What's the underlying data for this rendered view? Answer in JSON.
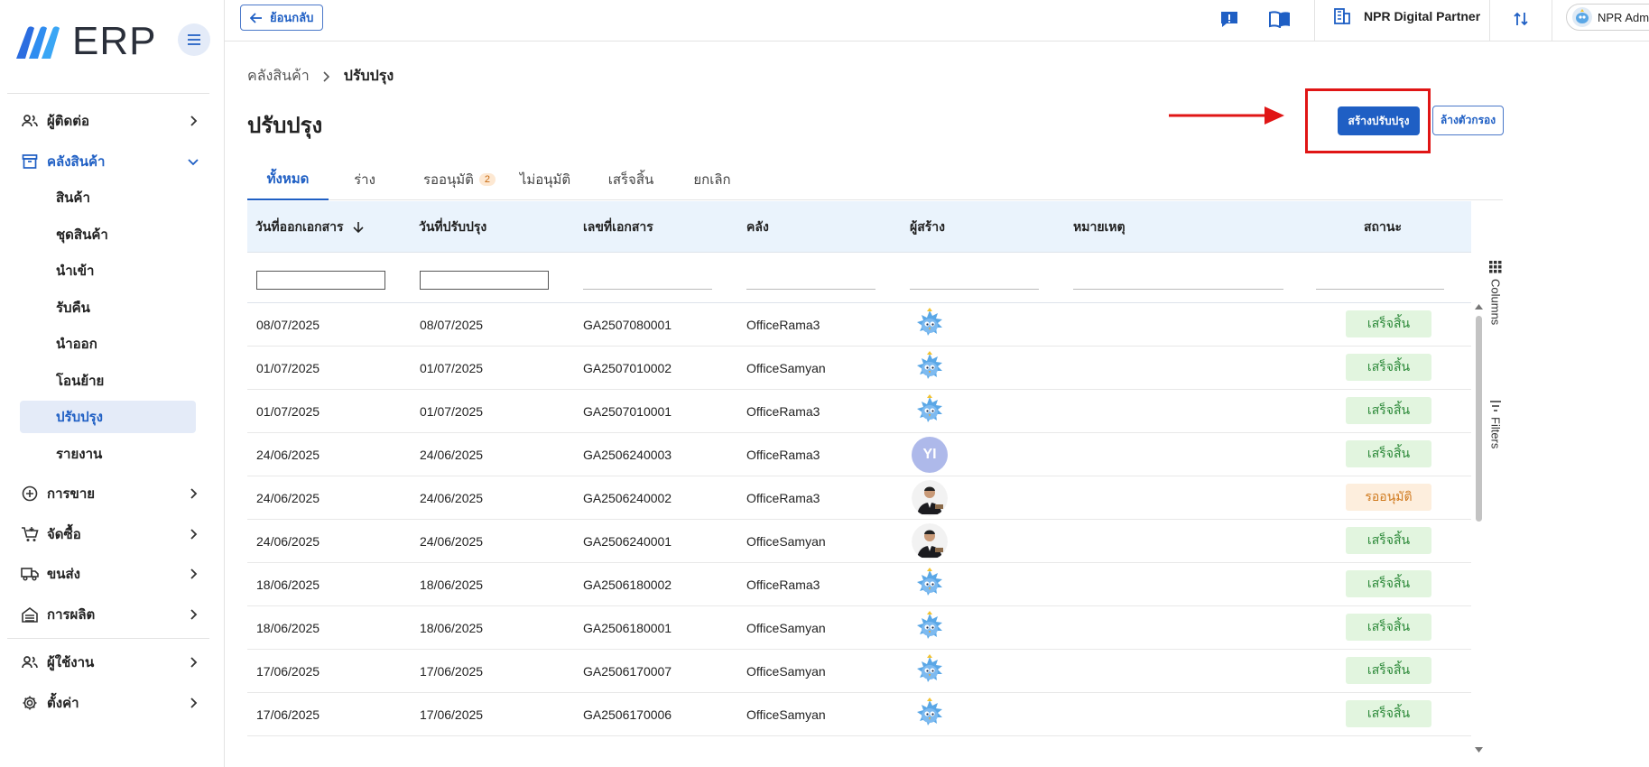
{
  "app": {
    "brand": "ERP"
  },
  "sidebar": {
    "items": [
      {
        "label": "ผู้ติดต่อ",
        "icon": "contacts-icon"
      },
      {
        "label": "คลังสินค้า",
        "icon": "warehouse-icon"
      },
      {
        "label": "การขาย",
        "icon": "sales-icon"
      },
      {
        "label": "จัดซื้อ",
        "icon": "cart-icon"
      },
      {
        "label": "ขนส่ง",
        "icon": "truck-icon"
      },
      {
        "label": "การผลิต",
        "icon": "factory-icon"
      },
      {
        "label": "ผู้ใช้งาน",
        "icon": "users-icon"
      },
      {
        "label": "ตั้งค่า",
        "icon": "gear-icon"
      }
    ],
    "sub_items": [
      "สินค้า",
      "ชุดสินค้า",
      "นำเข้า",
      "รับคืน",
      "นำออก",
      "โอนย้าย",
      "ปรับปรุง",
      "รายงาน"
    ],
    "selected_sub": "ปรับปรุง"
  },
  "topbar": {
    "back_label": "ย้อนกลับ",
    "company": "NPR Digital Partner",
    "user": "NPR Admin"
  },
  "breadcrumb": {
    "parent": "คลังสินค้า",
    "current": "ปรับปรุง"
  },
  "page": {
    "title": "ปรับปรุง",
    "create_label": "สร้างปรับปรุง",
    "clear_filter_label": "ล้างตัวกรอง"
  },
  "tabs": [
    {
      "label": "ทั้งหมด"
    },
    {
      "label": "ร่าง"
    },
    {
      "label": "รออนุมัติ",
      "badge": "2"
    },
    {
      "label": "ไม่อนุมัติ"
    },
    {
      "label": "เสร็จสิ้น"
    },
    {
      "label": "ยกเลิก"
    }
  ],
  "table": {
    "columns": [
      "วันที่ออกเอกสาร",
      "วันที่ปรับปรุง",
      "เลขที่เอกสาร",
      "คลัง",
      "ผู้สร้าง",
      "หมายเหตุ",
      "สถานะ"
    ],
    "rows": [
      {
        "issue_date": "08/07/2025",
        "adjust_date": "08/07/2025",
        "doc_no": "GA2507080001",
        "warehouse": "OfficeRama3",
        "creator": "bird",
        "status": "เสร็จสิ้น"
      },
      {
        "issue_date": "01/07/2025",
        "adjust_date": "01/07/2025",
        "doc_no": "GA2507010002",
        "warehouse": "OfficeSamyan",
        "creator": "bird",
        "status": "เสร็จสิ้น"
      },
      {
        "issue_date": "01/07/2025",
        "adjust_date": "01/07/2025",
        "doc_no": "GA2507010001",
        "warehouse": "OfficeRama3",
        "creator": "bird",
        "status": "เสร็จสิ้น"
      },
      {
        "issue_date": "24/06/2025",
        "adjust_date": "24/06/2025",
        "doc_no": "GA2506240003",
        "warehouse": "OfficeRama3",
        "creator": "YI",
        "status": "เสร็จสิ้น"
      },
      {
        "issue_date": "24/06/2025",
        "adjust_date": "24/06/2025",
        "doc_no": "GA2506240002",
        "warehouse": "OfficeRama3",
        "creator": "person",
        "status": "รออนุมัติ"
      },
      {
        "issue_date": "24/06/2025",
        "adjust_date": "24/06/2025",
        "doc_no": "GA2506240001",
        "warehouse": "OfficeSamyan",
        "creator": "person",
        "status": "เสร็จสิ้น"
      },
      {
        "issue_date": "18/06/2025",
        "adjust_date": "18/06/2025",
        "doc_no": "GA2506180002",
        "warehouse": "OfficeRama3",
        "creator": "bird",
        "status": "เสร็จสิ้น"
      },
      {
        "issue_date": "18/06/2025",
        "adjust_date": "18/06/2025",
        "doc_no": "GA2506180001",
        "warehouse": "OfficeSamyan",
        "creator": "bird",
        "status": "เสร็จสิ้น"
      },
      {
        "issue_date": "17/06/2025",
        "adjust_date": "17/06/2025",
        "doc_no": "GA2506170007",
        "warehouse": "OfficeSamyan",
        "creator": "bird",
        "status": "เสร็จสิ้น"
      },
      {
        "issue_date": "17/06/2025",
        "adjust_date": "17/06/2025",
        "doc_no": "GA2506170006",
        "warehouse": "OfficeSamyan",
        "creator": "bird",
        "status": "เสร็จสิ้น"
      }
    ]
  },
  "side_panel": {
    "columns_label": "Columns",
    "filters_label": "Filters"
  },
  "colors": {
    "primary": "#1f5fc4",
    "annotation_red": "#e01515",
    "done_bg": "#e2f5df",
    "pending_bg": "#fdeedd",
    "header_bg": "#eaf3fc"
  }
}
